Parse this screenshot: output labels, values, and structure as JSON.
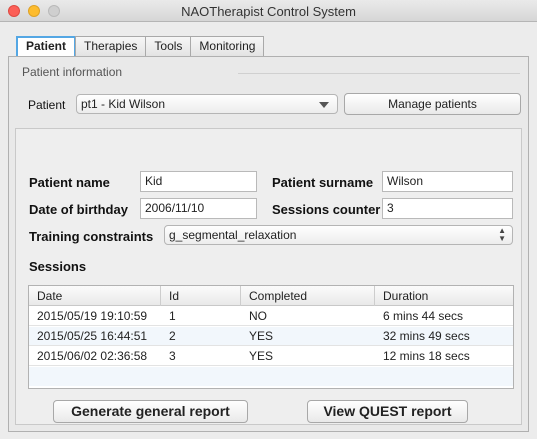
{
  "window": {
    "title": "NAOTherapist Control System"
  },
  "tabs": [
    "Patient",
    "Therapies",
    "Tools",
    "Monitoring"
  ],
  "patient_info": {
    "section_title": "Patient information",
    "patient_label": "Patient",
    "patient_selected": "pt1 - Kid Wilson",
    "manage_button": "Manage patients"
  },
  "details": {
    "name_label": "Patient name",
    "name_value": "Kid",
    "surname_label": "Patient surname",
    "surname_value": "Wilson",
    "birthday_label": "Date of birthday",
    "birthday_value": "2006/11/10",
    "sessions_counter_label": "Sessions counter",
    "sessions_counter_value": "3",
    "constraints_label": "Training constraints",
    "constraints_value": "g_segmental_relaxation"
  },
  "sessions": {
    "title": "Sessions",
    "columns": [
      "Date",
      "Id",
      "Completed",
      "Duration"
    ],
    "rows": [
      [
        "2015/05/19 19:10:59",
        "1",
        "NO",
        "6 mins 44 secs"
      ],
      [
        "2015/05/25 16:44:51",
        "2",
        "YES",
        "32 mins 49 secs"
      ],
      [
        "2015/06/02 02:36:58",
        "3",
        "YES",
        "12 mins 18 secs"
      ]
    ]
  },
  "buttons": {
    "general_report": "Generate general report",
    "quest_report": "View QUEST report"
  }
}
